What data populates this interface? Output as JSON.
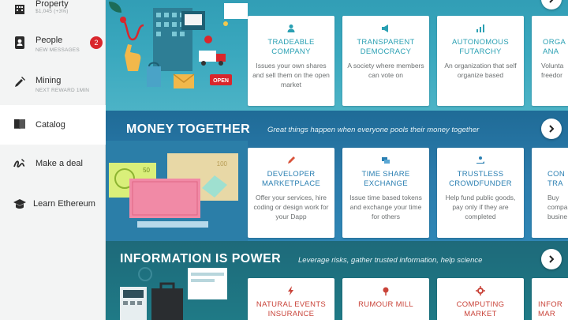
{
  "sidebar": {
    "items": [
      {
        "label": "Property",
        "sub": "$1,045 (+3%)",
        "icon": "building-icon"
      },
      {
        "label": "People",
        "sub": "NEW MESSAGES",
        "icon": "address-book-icon",
        "badge": "2"
      },
      {
        "label": "Mining",
        "sub": "NEXT REWARD 1MIN",
        "icon": "shovel-icon"
      },
      {
        "label": "Catalog",
        "sub": "",
        "icon": "book-icon"
      },
      {
        "label": "Make a deal",
        "sub": "",
        "icon": "signature-icon"
      },
      {
        "label": "Learn Ethereum",
        "sub": "",
        "icon": "graduation-cap-icon"
      }
    ]
  },
  "sections": {
    "hero": {
      "title": "",
      "tagline": "",
      "illustration_sign": "OPEN",
      "cards": [
        {
          "title": "TRADEABLE COMPANY",
          "desc": "Issues your own shares and sell them on the open market",
          "icon": "person-icon"
        },
        {
          "title": "TRANSPARENT DEMOCRACY",
          "desc": "A society where members can vote on",
          "icon": "megaphone-icon"
        },
        {
          "title": "AUTONOMOUS FUTARCHY",
          "desc": "An organization that self organize based",
          "icon": "chart-icon"
        },
        {
          "title": "ORGA ANA",
          "desc": "Volunta freedor",
          "icon": "org-icon"
        }
      ]
    },
    "money": {
      "title": "MONEY TOGETHER",
      "tagline": "Great things happen when everyone pools their money together",
      "bill_value": "50",
      "bill_value_2": "100",
      "cards": [
        {
          "title": "DEVELOPER MARKETPLACE",
          "desc": "Offer your services, hire coding or design work for your Dapp",
          "icon": "pencil-icon"
        },
        {
          "title": "TIME SHARE EXCHANGE",
          "desc": "Issue time based tokens and exchange your time for others",
          "icon": "stack-icon"
        },
        {
          "title": "TRUSTLESS CROWDFUNDER",
          "desc": "Help fund public goods, pay only if they are completed",
          "icon": "hand-coins-icon"
        },
        {
          "title": "CON TRA",
          "desc": "Buy compa busine",
          "icon": "contract-icon"
        }
      ]
    },
    "info": {
      "title": "INFORMATION IS POWER",
      "tagline": "Leverage risks, gather trusted information, help science",
      "cards": [
        {
          "title": "NATURAL EVENTS INSURANCE",
          "desc": "",
          "icon": "bolt-icon"
        },
        {
          "title": "RUMOUR MILL",
          "desc": "",
          "icon": "pin-icon"
        },
        {
          "title": "COMPUTING MARKET",
          "desc": "",
          "icon": "gear-icon"
        },
        {
          "title": "INFOR MAR",
          "desc": "",
          "icon": "info-icon"
        }
      ]
    }
  },
  "colors": {
    "hero_bg": "#3aa8be",
    "money_bg": "#2b7bab",
    "info_bg": "#1f7a86",
    "badge": "#d9262c",
    "hero_card_title": "#2aa0b3",
    "money_card_title": "#2a7fb2",
    "info_card_title": "#c94339"
  }
}
